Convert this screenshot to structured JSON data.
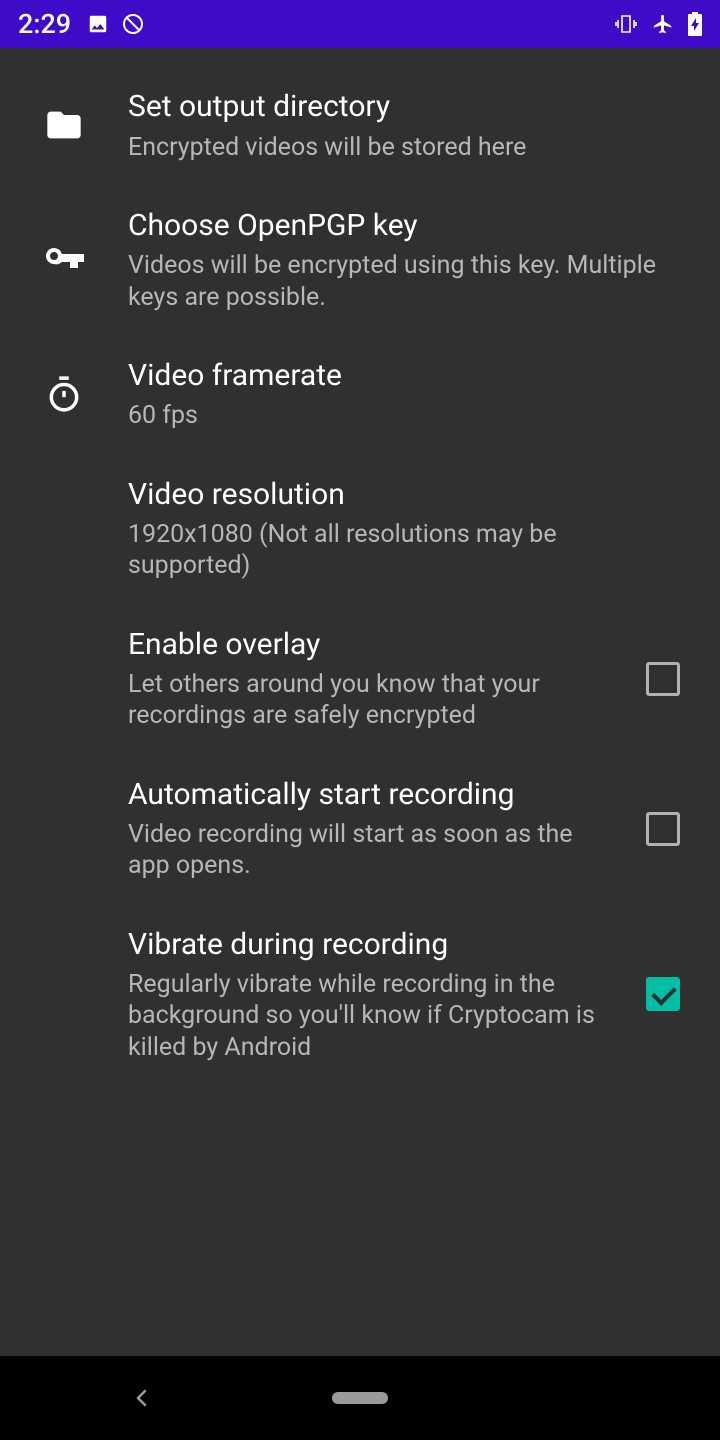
{
  "status": {
    "time": "2:29"
  },
  "settings": {
    "output_dir": {
      "title": "Set output directory",
      "sub": "Encrypted videos will be stored here"
    },
    "pgp_key": {
      "title": "Choose OpenPGP key",
      "sub": "Videos will be encrypted using this key. Multiple keys are possible."
    },
    "framerate": {
      "title": "Video framerate",
      "sub": "60 fps"
    },
    "resolution": {
      "title": "Video resolution",
      "sub": "1920x1080 (Not all resolutions may be supported)"
    },
    "overlay": {
      "title": "Enable overlay",
      "sub": "Let others around you know that your recordings are safely encrypted",
      "checked": false
    },
    "autostart": {
      "title": "Automatically start recording",
      "sub": "Video recording will start as soon as the app opens.",
      "checked": false
    },
    "vibrate": {
      "title": "Vibrate during recording",
      "sub": "Regularly vibrate while recording in the background so you'll know if Cryptocam is killed by Android",
      "checked": true
    }
  }
}
